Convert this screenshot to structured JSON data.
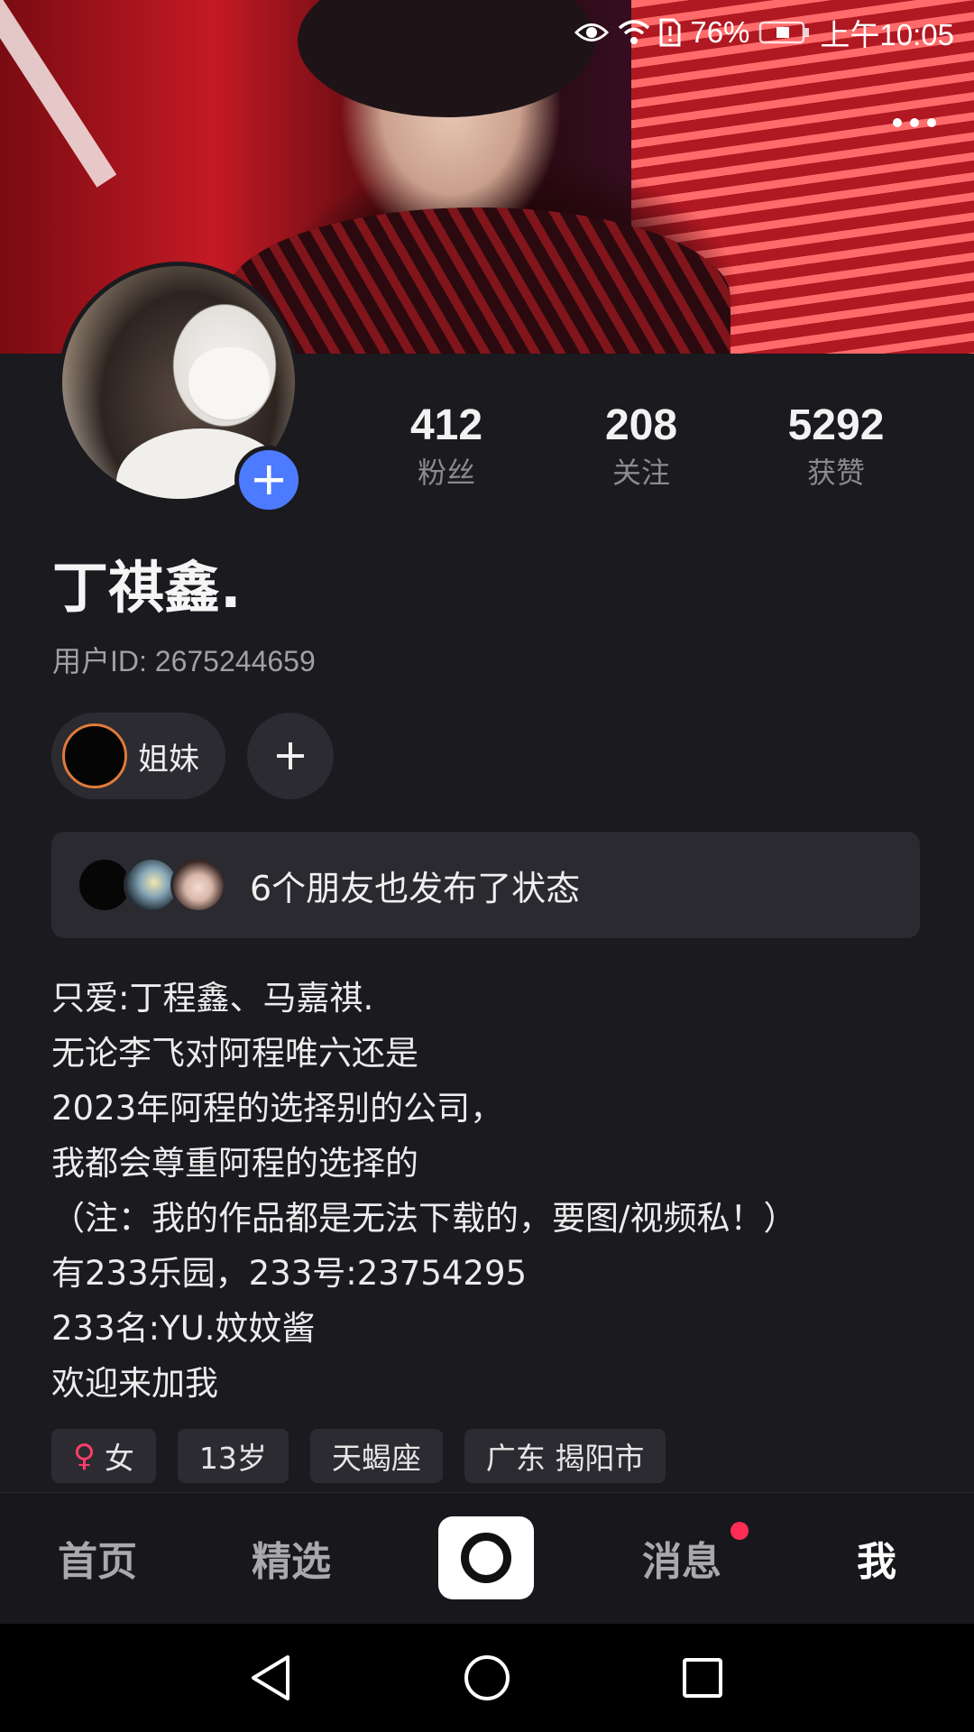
{
  "status_bar": {
    "battery": "76%",
    "time": "上午10:05"
  },
  "profile": {
    "name": "丁祺鑫.",
    "user_id": "用户ID: 2675244659",
    "stats": [
      {
        "value": "412",
        "label": "粉丝"
      },
      {
        "value": "208",
        "label": "关注"
      },
      {
        "value": "5292",
        "label": "获赞"
      }
    ],
    "relation_chip": "姐妹",
    "friends_status": "6个朋友也发布了状态",
    "bio_lines": [
      "只爱:丁程鑫、马嘉祺.",
      "无论李飞对阿程唯六还是",
      "2023年阿程的选择别的公司，",
      "我都会尊重阿程的选择的",
      "（注：我的作品都是无法下载的，要图/视频私！）",
      "有233乐园，233号:23754295",
      "233名:YU.妏妏酱",
      "欢迎来加我"
    ],
    "tags": [
      {
        "icon": "female-icon",
        "label": "女"
      },
      {
        "label": "13岁"
      },
      {
        "label": "天蝎座"
      },
      {
        "label": "广东 揭阳市"
      }
    ]
  },
  "tab_bar": {
    "home": "首页",
    "featured": "精选",
    "messages": "消息",
    "me": "我",
    "active": "me",
    "accent": "#ff2d55"
  },
  "colors": {
    "plus_badge": "#4d7bff",
    "background": "#1a1a1f"
  }
}
